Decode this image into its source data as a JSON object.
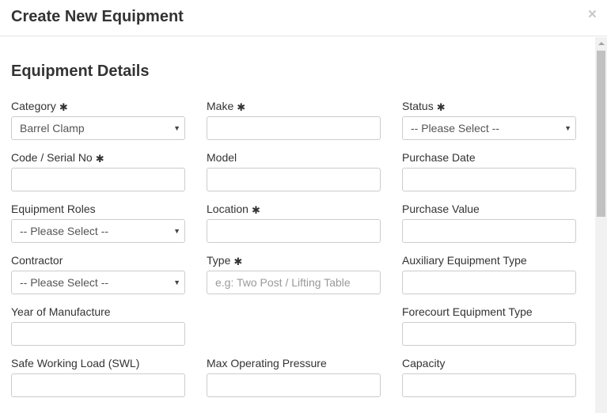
{
  "modal": {
    "title": "Create New Equipment",
    "close_glyph": "×"
  },
  "section": {
    "title": "Equipment Details"
  },
  "icons": {
    "required": "✱",
    "caret": "▼"
  },
  "fields": {
    "category": {
      "label": "Category",
      "value": "Barrel Clamp"
    },
    "make": {
      "label": "Make",
      "value": ""
    },
    "status": {
      "label": "Status",
      "value": "-- Please Select --"
    },
    "code": {
      "label": "Code / Serial No",
      "value": ""
    },
    "model": {
      "label": "Model",
      "value": ""
    },
    "purchase_date": {
      "label": "Purchase Date",
      "value": ""
    },
    "equipment_roles": {
      "label": "Equipment Roles",
      "value": "-- Please Select --"
    },
    "location": {
      "label": "Location",
      "value": ""
    },
    "purchase_value": {
      "label": "Purchase Value",
      "value": ""
    },
    "contractor": {
      "label": "Contractor",
      "value": "-- Please Select --"
    },
    "type": {
      "label": "Type",
      "value": "",
      "placeholder": "e.g: Two Post / Lifting Table"
    },
    "aux_type": {
      "label": "Auxiliary Equipment Type",
      "value": ""
    },
    "year": {
      "label": "Year of Manufacture",
      "value": ""
    },
    "forecourt_type": {
      "label": "Forecourt Equipment Type",
      "value": ""
    },
    "swl": {
      "label": "Safe Working Load (SWL)",
      "value": ""
    },
    "max_pressure": {
      "label": "Max Operating Pressure",
      "value": ""
    },
    "capacity": {
      "label": "Capacity",
      "value": ""
    }
  }
}
